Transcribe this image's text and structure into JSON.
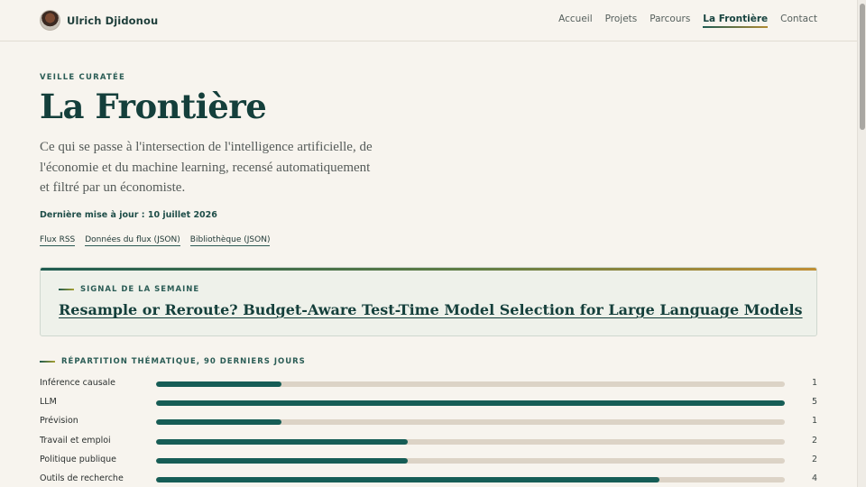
{
  "header": {
    "name": "Ulrich Djidonou",
    "nav": [
      {
        "label": "Accueil",
        "active": false
      },
      {
        "label": "Projets",
        "active": false
      },
      {
        "label": "Parcours",
        "active": false
      },
      {
        "label": "La Frontière",
        "active": true
      },
      {
        "label": "Contact",
        "active": false
      }
    ]
  },
  "hero": {
    "eyebrow": "VEILLE CURATÉE",
    "title": "La Frontière",
    "description": "Ce qui se passe à l'intersection de l'intelligence artificielle, de l'économie et du machine learning, recensé automatiquement et filtré par un économiste.",
    "updated": "Dernière mise à jour : 10 juillet 2026",
    "links": [
      "Flux RSS",
      "Données du flux (JSON)",
      "Bibliothèque (JSON)"
    ]
  },
  "signal": {
    "label": "SIGNAL DE LA SEMAINE",
    "title": "Resample or Reroute? Budget-Aware Test-Time Model Selection for Large Language Models"
  },
  "breakdown": {
    "label": "RÉPARTITION THÉMATIQUE, 90 DERNIERS JOURS",
    "max": 5,
    "rows": [
      {
        "label": "Inférence causale",
        "count": 1
      },
      {
        "label": "LLM",
        "count": 5
      },
      {
        "label": "Prévision",
        "count": 1
      },
      {
        "label": "Travail et emploi",
        "count": 2
      },
      {
        "label": "Politique publique",
        "count": 2
      },
      {
        "label": "Outils de recherche",
        "count": 4
      }
    ]
  },
  "colors": {
    "accent": "#165d56",
    "track": "#dcd3c6",
    "background": "#f7f4ee",
    "gold": "#c08f35"
  }
}
